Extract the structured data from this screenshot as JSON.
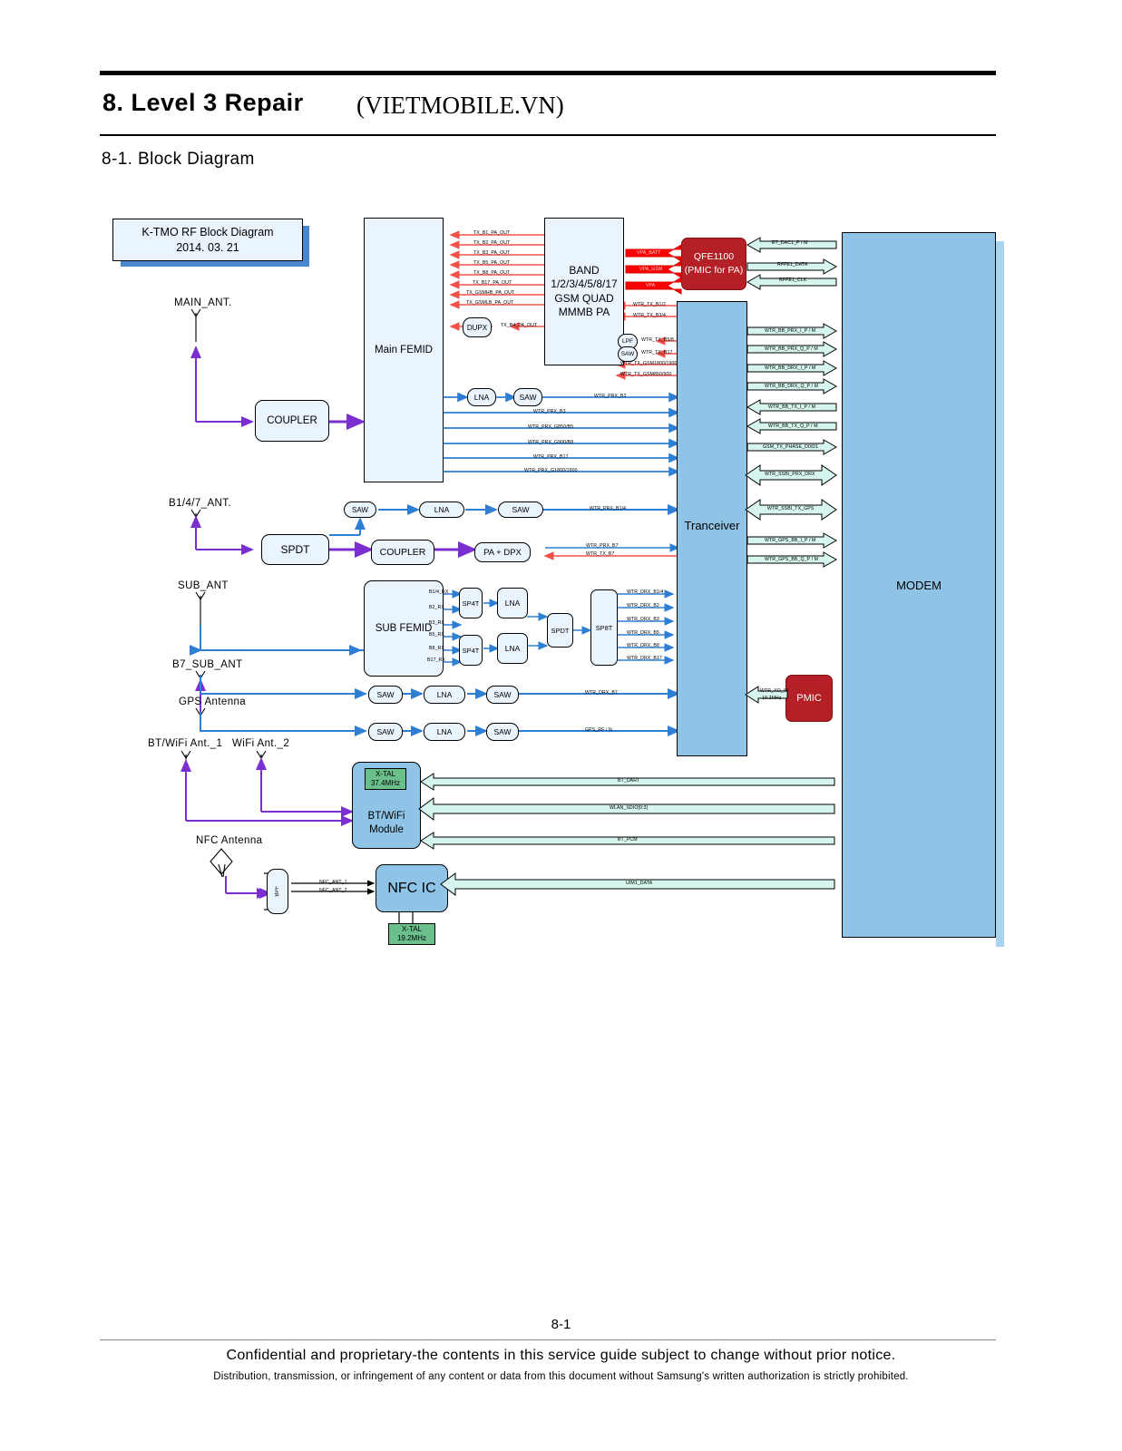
{
  "header": {
    "chapter_title": "8. Level 3 Repair",
    "watermark": "(VIETMOBILE.VN)",
    "section_title": "8-1. Block Diagram"
  },
  "footer": {
    "page_number": "8-1",
    "confidential_line": "Confidential and proprietary-the contents in this service guide subject to change without prior notice.",
    "distribution_line": "Distribution, transmission, or infringement of any content or data from this document without Samsung's written authorization is strictly prohibited."
  },
  "diagram": {
    "title_box": {
      "line1": "K-TMO RF Block Diagram",
      "line2": "2014. 03. 21"
    },
    "antennas": [
      {
        "name": "MAIN_ANT."
      },
      {
        "name": "B1/4/7_ANT."
      },
      {
        "name": "SUB_ANT"
      },
      {
        "name": "B7_SUB_ANT"
      },
      {
        "name": "GPS Antenna"
      },
      {
        "name": "BT/WiFi Ant._1"
      },
      {
        "name": "WiFi Ant._2"
      },
      {
        "name": "NFC Antenna"
      }
    ],
    "blocks": {
      "main_femid": "Main FEMID",
      "sub_femid": "SUB FEMID",
      "coupler1": "COUPLER",
      "coupler2": "COUPLER",
      "spdt_ant": "SPDT",
      "spdt_rx": "SPDT",
      "sp8t": "SP8T",
      "sp4t_a": "SP4T",
      "sp4t_b": "SP4T",
      "lna_a": "LNA",
      "lna_b": "LNA",
      "pa_dpx": "PA + DPX",
      "dupx": "DUPX",
      "lpf": "LPF",
      "saw_small": "SAW",
      "band_pa": "BAND\n1/2/3/4/5/8/17\nGSM QUAD\nMMMB PA",
      "band_pa_l1": "BAND",
      "band_pa_l2": "1/2/3/4/5/8/17",
      "band_pa_l3": "GSM QUAD",
      "band_pa_l4": "MMMB PA",
      "qfe1100_l1": "QFE1100",
      "qfe1100_l2": "(PMIC for PA)",
      "transceiver": "Tranceiver",
      "modem": "MODEM",
      "pmic": "PMIC",
      "bt_wifi_l1": "BT/WiFi",
      "bt_wifi_l2": "Module",
      "xtal_bt_l1": "X-TAL",
      "xtal_bt_l2": "37.4MHz",
      "nfc_ic": "NFC IC",
      "xtal_nfc_l1": "X-TAL",
      "xtal_nfc_l2": "19.2MHz",
      "bpf": "BPF",
      "lna_main": "LNA",
      "saw_main": "SAW",
      "saw_b14_a": "SAW",
      "lna_b14": "LNA",
      "saw_b14_b": "SAW",
      "saw_b7_a": "SAW",
      "lna_b7": "LNA",
      "saw_b7_b": "SAW",
      "saw_gps_a": "SAW",
      "lna_gps": "LNA",
      "saw_gps_b": "SAW"
    },
    "tx_pa_out": [
      "TX_B1_PA_OUT",
      "TX_B2_PA_OUT",
      "TX_B3_PA_OUT",
      "TX_B5_PA_OUT",
      "TX_B8_PA_OUT",
      "TX_B17_PA_OUT",
      "TX_GSMHB_PA_OUT",
      "TX_GSMLB_PA_OUT"
    ],
    "tx_b4_pa_out": "TX_B4_PA_OUT",
    "vpa_rails": [
      "VPA_BATT",
      "VPA_GSM",
      "VPA"
    ],
    "wtr_tx": [
      "WTR_TX_B1/2",
      "WTR_TX_B3/4",
      "WTR_TX_B5/8",
      "WTR_TX_B17",
      "WTR_TX_GSM1800/1900",
      "WTR_TX_GSM850/900"
    ],
    "wtr_prx": [
      "WTR_PRX_B2",
      "WTR_PRX_B3",
      "WTR_PRX_G850/B5",
      "WTR_PRX_G900/B8",
      "WTR_PRX_B17",
      "WTR_PRX_G1800/1900"
    ],
    "wtr_prx_b14": "WTR_PRX_B1/4",
    "wtr_b7_pair": [
      "WTR_PRX_B7",
      "WTR_TX_B7"
    ],
    "sub_femid_ports": [
      "B1/4_RX",
      "B2_RX",
      "B3_RX",
      "B5_RX",
      "B8_RX",
      "B17_RX"
    ],
    "wtr_drx": [
      "WTR_DRX_B1/4",
      "WTR_DRX_B2",
      "WTR_DRX_B3",
      "WTR_DRX_B5",
      "WTR_DRX_B8",
      "WTR_DRX_B17"
    ],
    "wtr_drx_b7": "WTR_DRX_B7",
    "gps_rf": "GPS_RF / N",
    "modem_bus_top": [
      "ET_DAC1_P / M",
      "RFFE1_DATA",
      "RFFE1_CLK"
    ],
    "modem_bus_mid": [
      "WTR_BB_PRX_I_P / M",
      "WTR_BB_PRX_Q_P / M",
      "WTR_BB_DRX_I_P / M",
      "WTR_BB_DRX_Q_P / M",
      "WTR_BB_TX_I_P / M",
      "WTR_BB_TX_Q_P / M",
      "GSM_TX_PHASE_D0/D1",
      "WTR_SSBI_PRX_DRX",
      "WTR_SSBI_TX_GPS",
      "WTR_GPS_BB_I_P / M",
      "WTR_GPS_BB_Q_P / M"
    ],
    "pmic_xo_l1": "WTR_XO_IN",
    "pmic_xo_l2": "19.2MHz",
    "bt_buses": [
      "BT_UART",
      "WLAN_SDIO[0:3]",
      "BT_PCM"
    ],
    "nfc_bus": "UIM1_DATA",
    "nfc_ant_lines": [
      "NFC_ANT_1",
      "NFC_ANT_2"
    ]
  },
  "colors": {
    "light_blue_fill": "#eaf4fd",
    "blue_fill": "#8fc4e6",
    "red_block": "#b51f26",
    "green_block": "#6abf8a",
    "bus_fill": "#d6f5ee",
    "tx_line": "#f4504a",
    "rx_line": "#2e7fd4",
    "ant_line": "#7b2fd0"
  }
}
